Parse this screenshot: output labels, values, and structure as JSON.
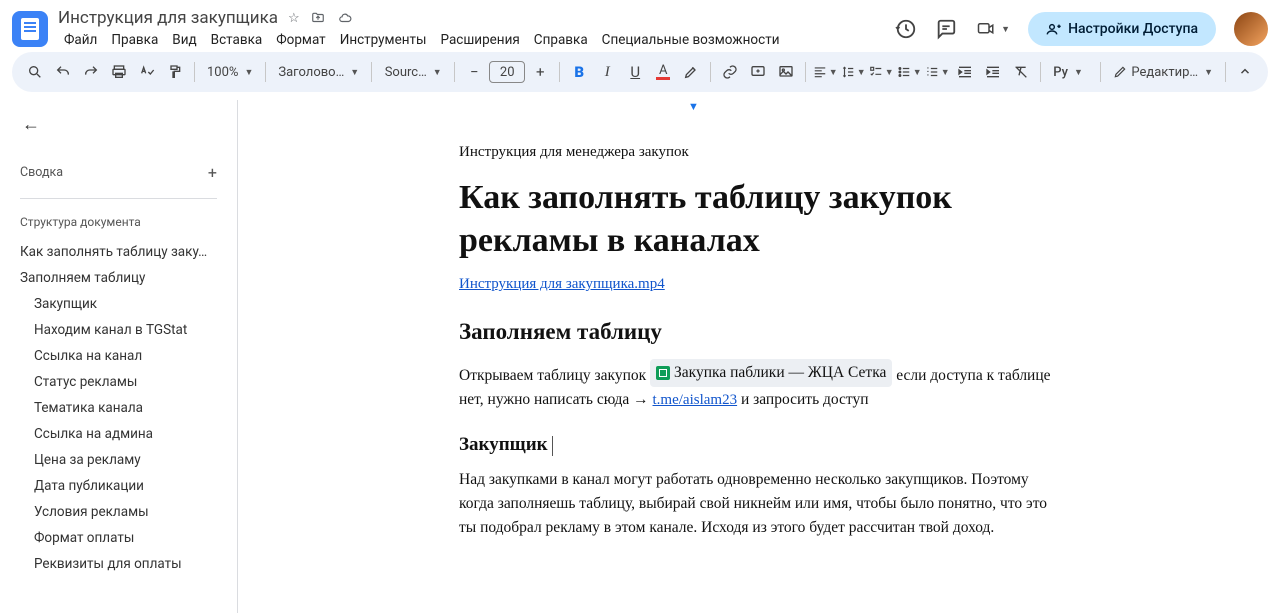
{
  "title": "Инструкция для закупщика",
  "menubar": [
    "Файл",
    "Правка",
    "Вид",
    "Вставка",
    "Формат",
    "Инструменты",
    "Расширения",
    "Справка",
    "Специальные возможности"
  ],
  "share_label": "Настройки Доступа",
  "toolbar": {
    "zoom": "100%",
    "styles": "Заголово…",
    "font": "Sourc…",
    "font_size": "20",
    "editing": "Редактир…"
  },
  "sidebar": {
    "summary_label": "Сводка",
    "outline_label": "Структура документа",
    "items": [
      {
        "level": 2,
        "label": "Как заполнять таблицу заку…"
      },
      {
        "level": 2,
        "label": "Заполняем таблицу"
      },
      {
        "level": 3,
        "label": "Закупщик"
      },
      {
        "level": 3,
        "label": "Находим канал в TGStat"
      },
      {
        "level": 3,
        "label": "Ссылка на канал"
      },
      {
        "level": 3,
        "label": "Статус рекламы"
      },
      {
        "level": 3,
        "label": "Тематика канала"
      },
      {
        "level": 3,
        "label": "Ссылка на админа"
      },
      {
        "level": 3,
        "label": "Цена за рекламу"
      },
      {
        "level": 3,
        "label": "Дата публикации"
      },
      {
        "level": 3,
        "label": "Условия рекламы"
      },
      {
        "level": 3,
        "label": "Формат оплаты"
      },
      {
        "level": 3,
        "label": "Реквизиты для оплаты"
      }
    ]
  },
  "doc": {
    "subtitle": "Инструкция для менеджера закупок",
    "h1": "Как заполнять таблицу закупок рекламы в каналах",
    "link1": "Инструкция для закупщика.mp4",
    "h2": "Заполняем таблицу",
    "para1_a": "Открываем таблицу закупок ",
    "chip1": "Закупка паблики — ЖЦА Сетка",
    "para1_b": "  если доступа к таблице нет, нужно написать сюда → ",
    "link2": "t.me/aislam23",
    "para1_c": "  и запросить доступ",
    "h3": "Закупщик",
    "para2": "Над закупками в канал могут работать одновременно несколько закупщиков. Поэтому когда заполняешь таблицу, выбирай свой никнейм или имя, чтобы было понятно, что это ты подобрал рекламу в этом канале. Исходя из этого будет рассчитан твой доход."
  }
}
